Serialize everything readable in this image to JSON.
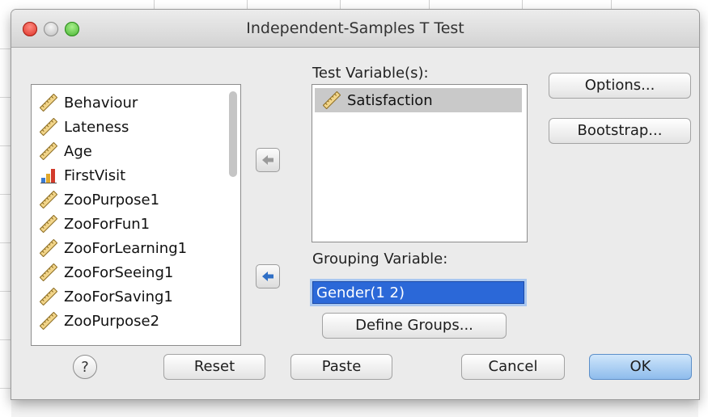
{
  "window": {
    "title": "Independent-Samples T Test"
  },
  "variables": {
    "items": [
      {
        "name": "Behaviour",
        "icon": "scale-ruler-icon"
      },
      {
        "name": "Lateness",
        "icon": "scale-ruler-icon"
      },
      {
        "name": "Age",
        "icon": "scale-ruler-icon"
      },
      {
        "name": "FirstVisit",
        "icon": "nominal-bars-icon"
      },
      {
        "name": "ZooPurpose1",
        "icon": "scale-ruler-icon"
      },
      {
        "name": "ZooForFun1",
        "icon": "scale-ruler-icon"
      },
      {
        "name": "ZooForLearning1",
        "icon": "scale-ruler-icon"
      },
      {
        "name": "ZooForSeeing1",
        "icon": "scale-ruler-icon"
      },
      {
        "name": "ZooForSaving1",
        "icon": "scale-ruler-icon"
      },
      {
        "name": "ZooPurpose2",
        "icon": "scale-ruler-icon"
      }
    ]
  },
  "test_variables": {
    "label": "Test Variable(s):",
    "items": [
      {
        "name": "Satisfaction",
        "icon": "scale-ruler-icon"
      }
    ]
  },
  "grouping": {
    "label": "Grouping Variable:",
    "value": "Gender(1 2)",
    "define_label": "Define Groups..."
  },
  "side_buttons": {
    "options": "Options...",
    "bootstrap": "Bootstrap..."
  },
  "footer": {
    "help": "?",
    "reset": "Reset",
    "paste": "Paste",
    "cancel": "Cancel",
    "ok": "OK"
  },
  "colors": {
    "selection": "#2b68d8",
    "ok_button": "#8ebcec",
    "close": "#d92a1f",
    "zoom": "#3fae2a"
  }
}
